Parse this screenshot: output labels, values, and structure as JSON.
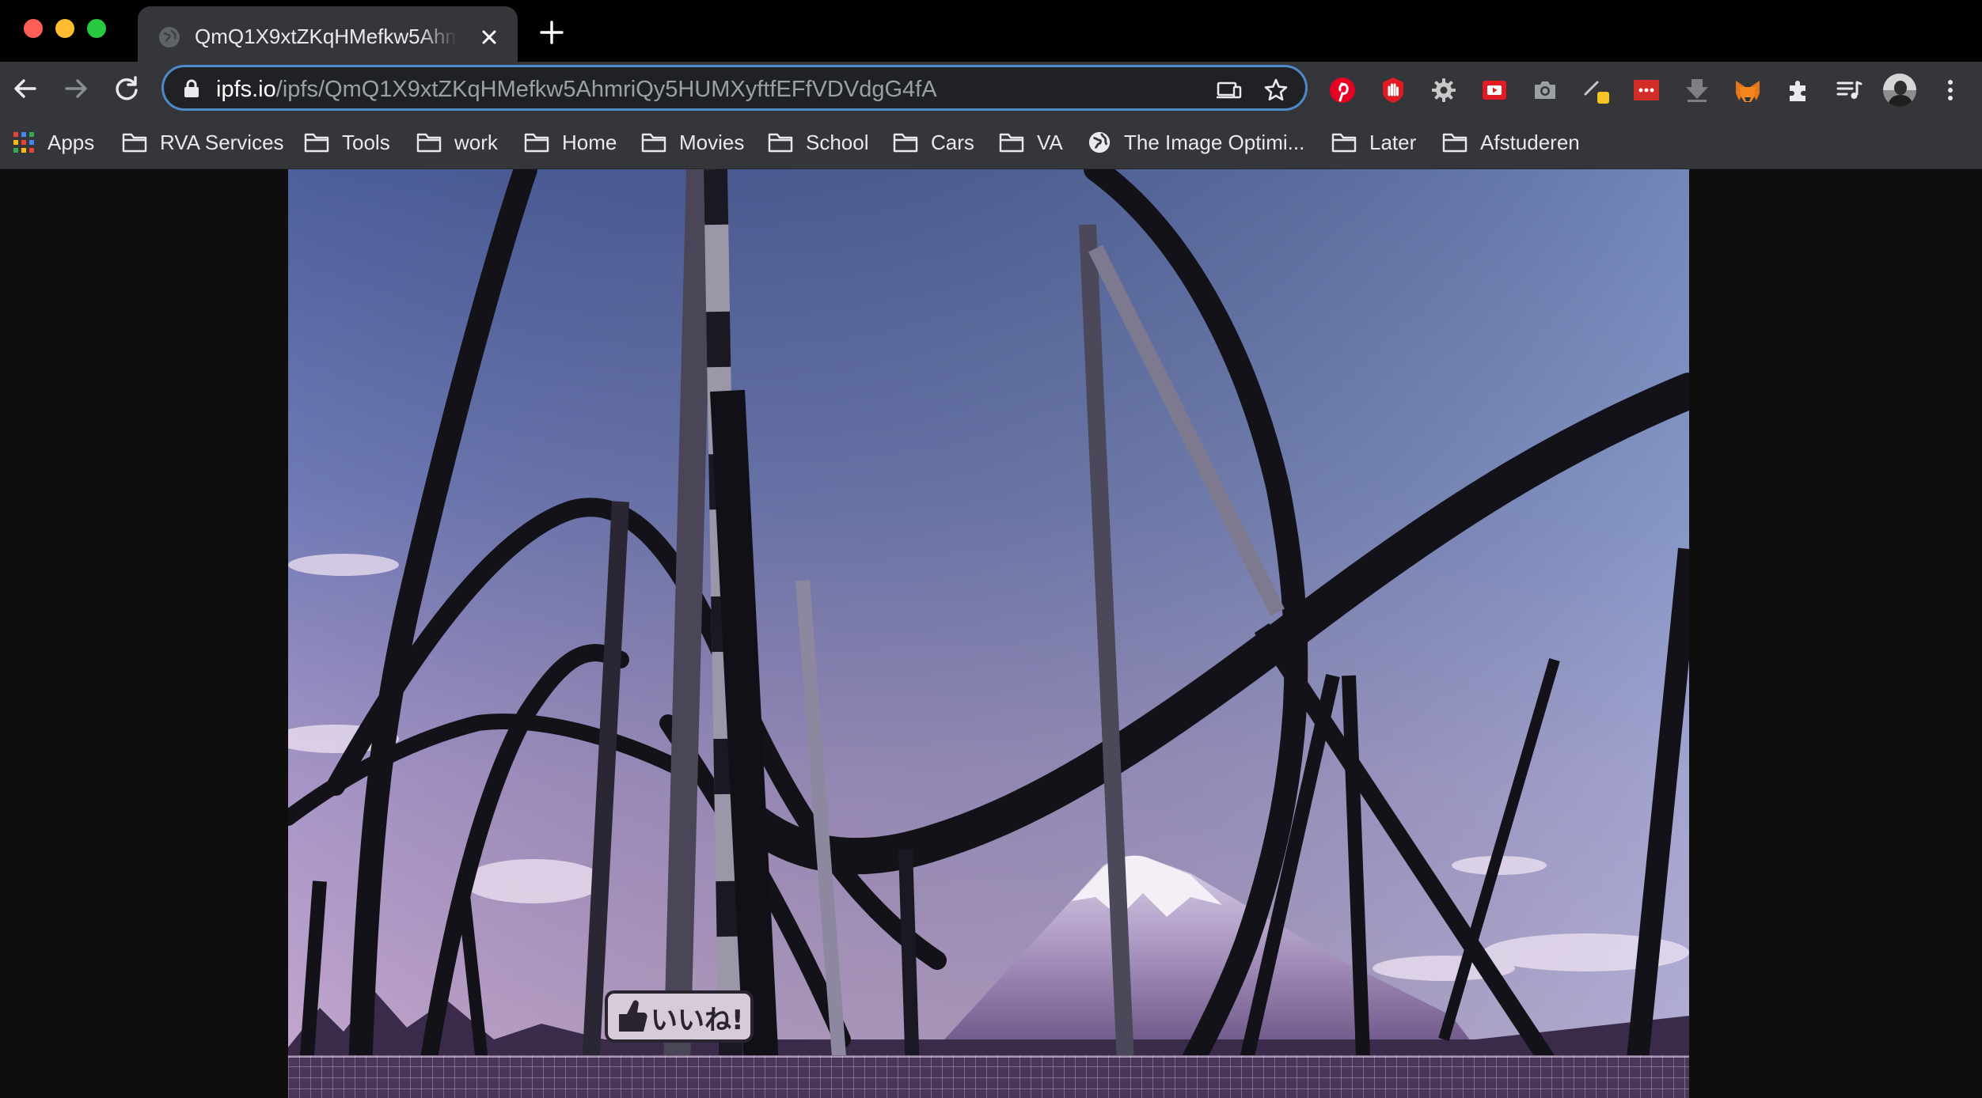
{
  "tab": {
    "title": "QmQ1X9xtZKqHMefkw5AhmriQy5HUMXyftfEFfVDVdgG4fA"
  },
  "address_bar": {
    "host": "ipfs.io",
    "path": "/ipfs/QmQ1X9xtZKqHMefkw5AhmriQy5HUMXyftfEFfVDVdgG4fA"
  },
  "bookmarks": [
    {
      "label": "Apps",
      "icon": "apps-grid-icon"
    },
    {
      "label": "RVA Services",
      "icon": "folder-icon"
    },
    {
      "label": "Tools",
      "icon": "folder-icon"
    },
    {
      "label": "work",
      "icon": "folder-icon"
    },
    {
      "label": "Home",
      "icon": "folder-icon"
    },
    {
      "label": "Movies",
      "icon": "folder-icon"
    },
    {
      "label": "School",
      "icon": "folder-icon"
    },
    {
      "label": "Cars",
      "icon": "folder-icon"
    },
    {
      "label": "VA",
      "icon": "folder-icon"
    },
    {
      "label": "The Image Optimi...",
      "icon": "globe-icon"
    },
    {
      "label": "Later",
      "icon": "folder-icon"
    },
    {
      "label": "Afstuderen",
      "icon": "folder-icon"
    }
  ],
  "extensions": [
    "pinterest-icon",
    "stop-hand-icon",
    "gear-icon",
    "youtube-icon",
    "camera-icon",
    "color-picker-icon",
    "lastpass-icon",
    "download-icon",
    "metamask-icon",
    "puzzle-icon",
    "media-queue-icon",
    "profile-avatar"
  ],
  "image": {
    "alt_subject": "roller coaster with Mount Fuji",
    "sign_text": "いいね!"
  },
  "colors": {
    "accent": "#4d8ac9",
    "toolbar": "#35363a",
    "tabstrip": "#000000"
  }
}
